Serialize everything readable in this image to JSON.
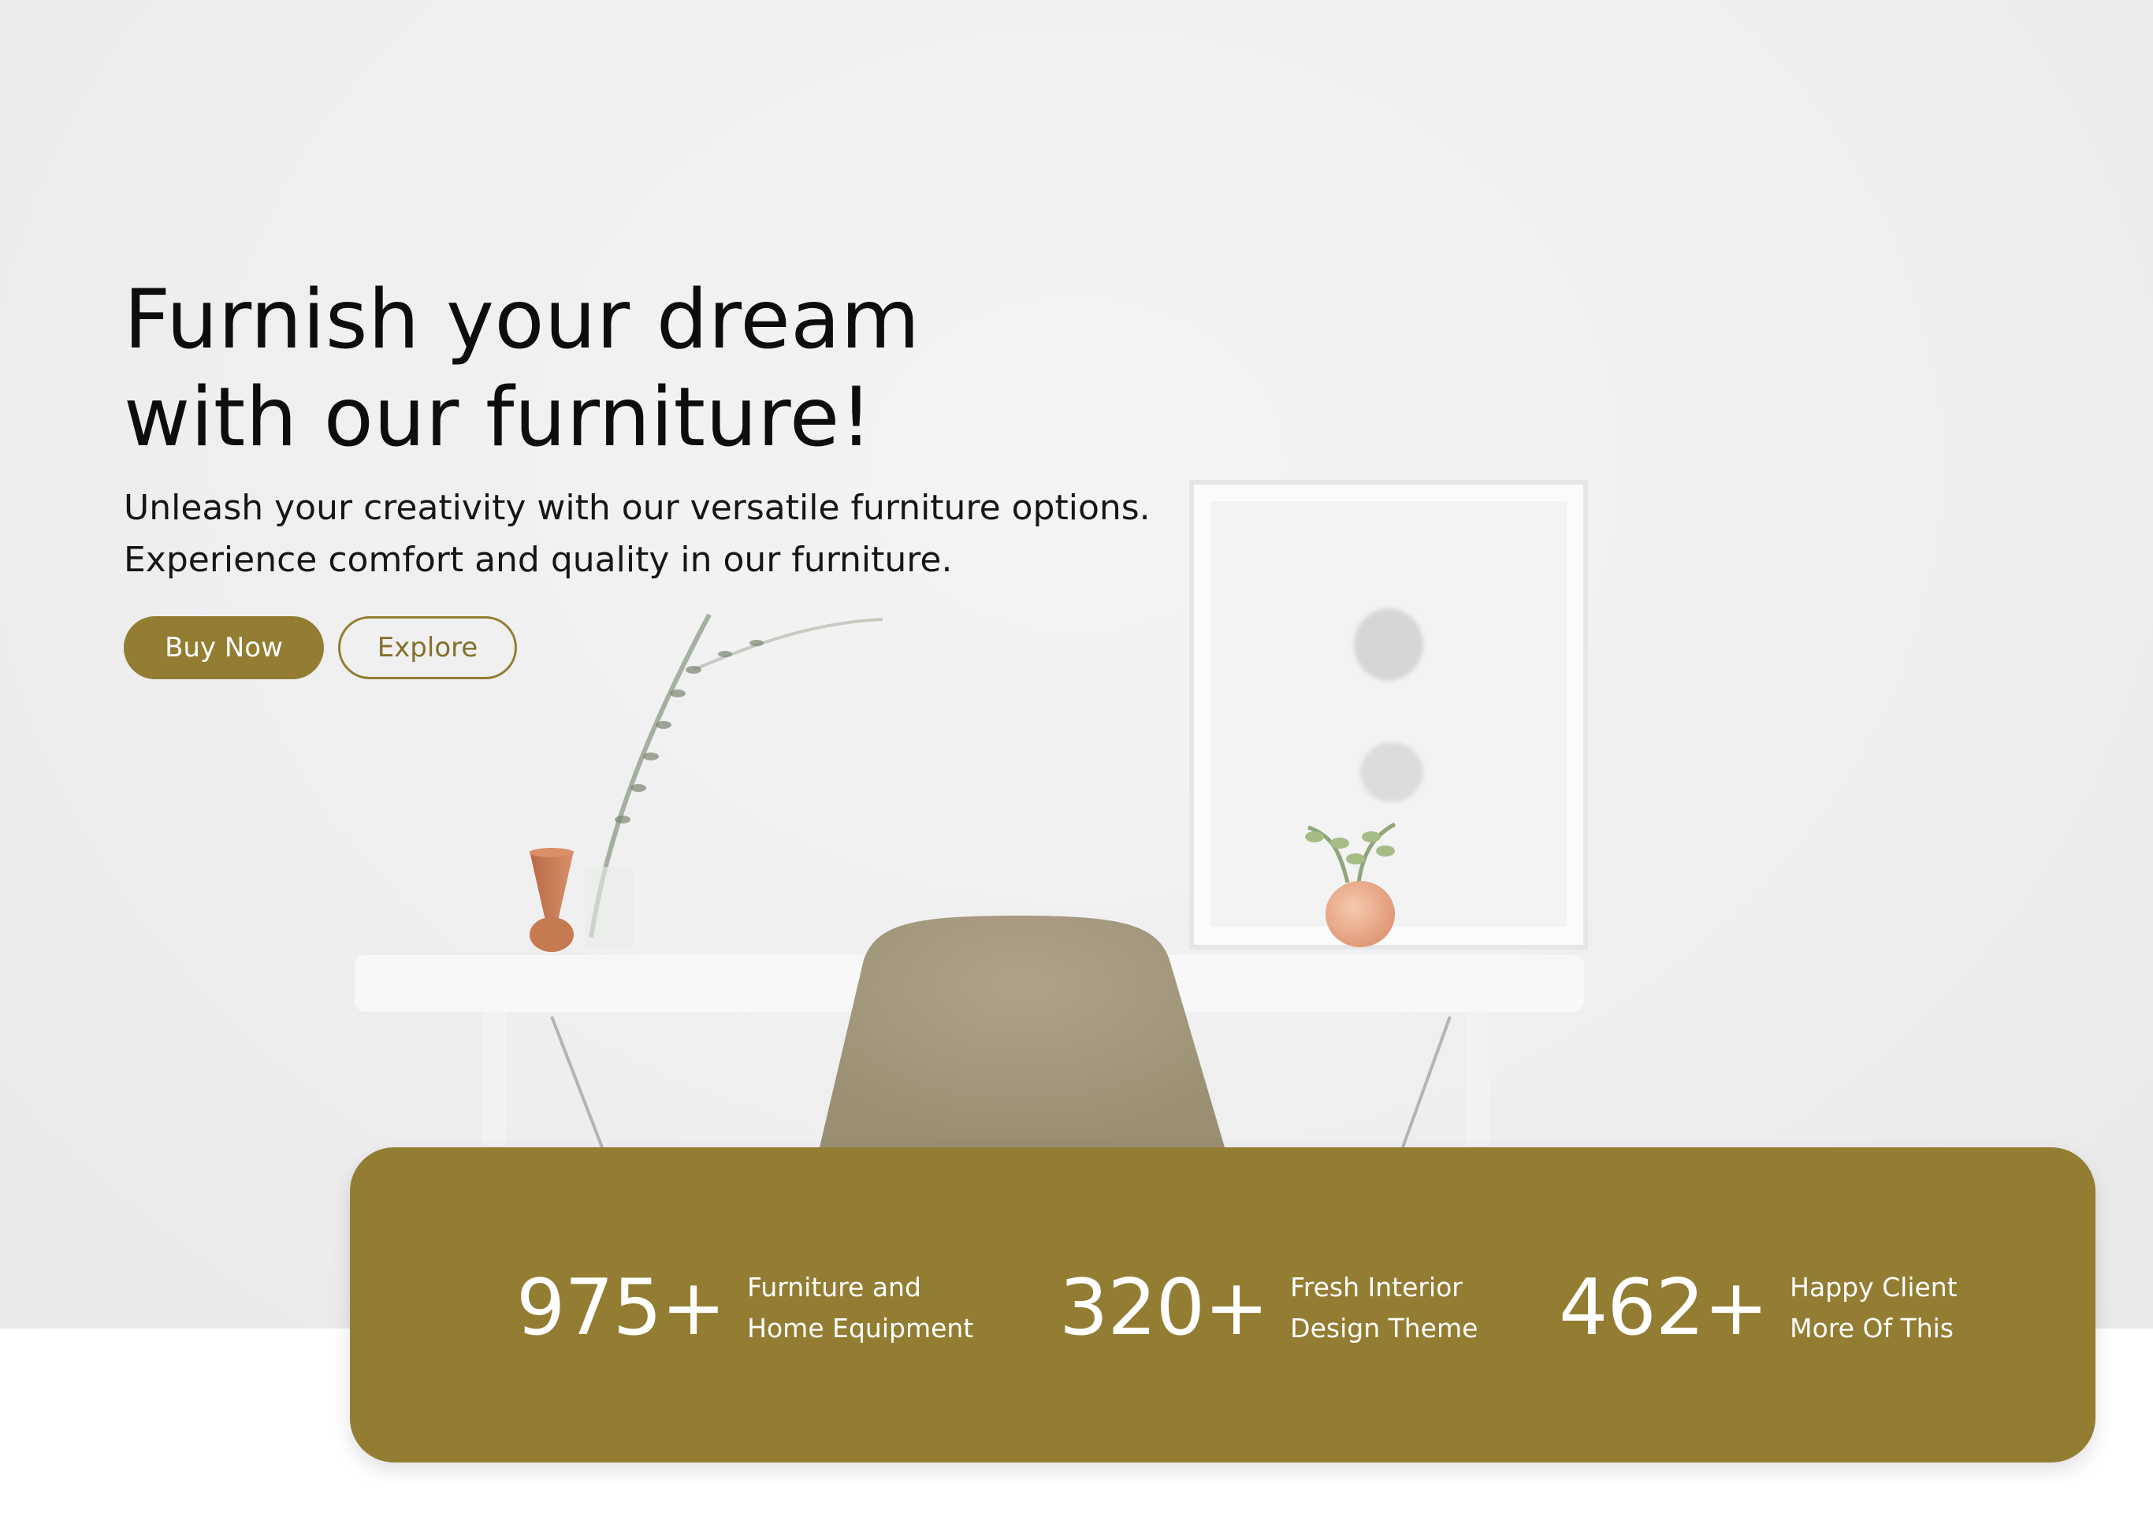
{
  "hero": {
    "title_line1": "Furnish your dream",
    "title_line2": "with our furniture!",
    "subtitle_line1": "Unleash your creativity with our versatile furniture options.",
    "subtitle_line2": "Experience comfort and quality in our furniture.",
    "buy_label": "Buy Now",
    "explore_label": "Explore"
  },
  "stats": [
    {
      "value": "975+",
      "label_line1": "Furniture and",
      "label_line2": "Home Equipment"
    },
    {
      "value": "320+",
      "label_line1": "Fresh Interior",
      "label_line2": "Design Theme"
    },
    {
      "value": "462+",
      "label_line1": "Happy Client",
      "label_line2": "More Of This"
    }
  ],
  "colors": {
    "accent": "#937d33",
    "hero_background": "#efeff0",
    "text_dark": "#0d0d0d",
    "text_light": "#ffffff"
  }
}
